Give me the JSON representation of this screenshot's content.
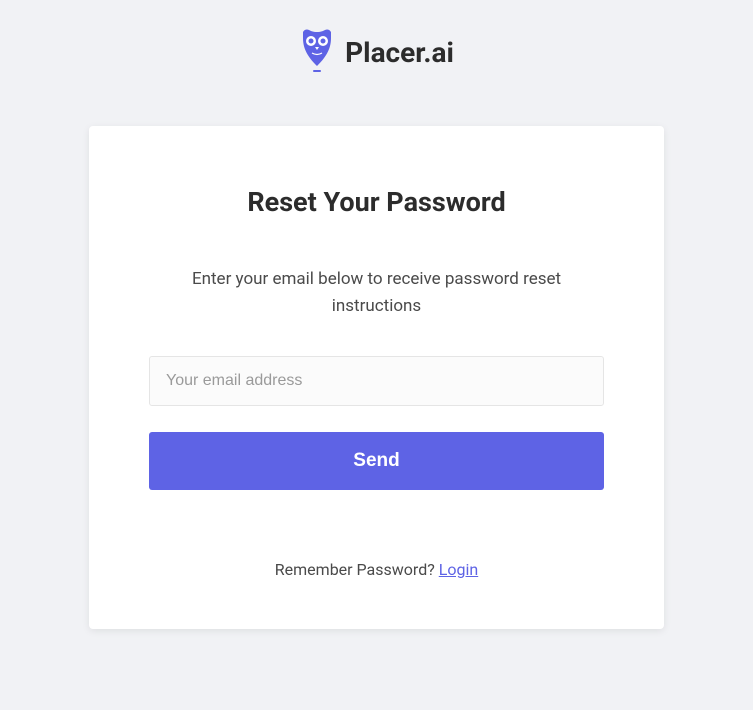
{
  "brand": {
    "name": "Placer.ai",
    "accent_color": "#5e63e5"
  },
  "card": {
    "title": "Reset Your Password",
    "description": "Enter your email below to receive password reset instructions",
    "email_placeholder": "Your email address",
    "email_value": "",
    "send_button_label": "Send",
    "footer_prompt": "Remember Password? ",
    "login_link_label": "Login"
  }
}
